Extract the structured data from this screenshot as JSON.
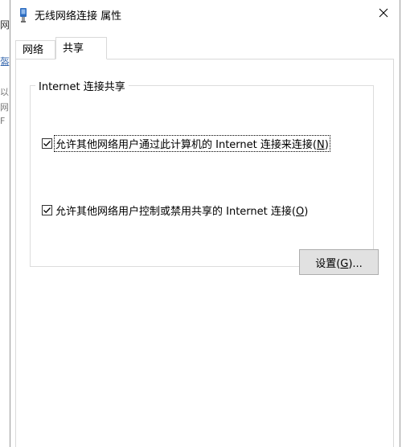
{
  "background": {
    "fragments": [
      "网",
      "盔",
      "以",
      "网",
      "F"
    ]
  },
  "dialog": {
    "title": "无线网络连接 属性",
    "close_glyph": "✕",
    "tabs": [
      {
        "label": "网络",
        "active": false
      },
      {
        "label": "共享",
        "active": true
      }
    ],
    "group": {
      "legend": "Internet 连接共享",
      "options": [
        {
          "label_pre": "允许其他网络用户通过此计算机的 Internet 连接来连接(",
          "accel": "N",
          "label_post": ")",
          "checked": true
        },
        {
          "label_pre": "允许其他网络用户控制或禁用共享的 Internet 连接(",
          "accel": "O",
          "label_post": ")",
          "checked": true
        }
      ],
      "settings_button": {
        "label_pre": "设置(",
        "accel": "G",
        "label_post": ")..."
      }
    }
  },
  "colors": {
    "border": "#d9d9d9",
    "button_bg": "#e1e1e1",
    "button_border": "#adadad",
    "icon_blue": "#2d6cc0"
  }
}
